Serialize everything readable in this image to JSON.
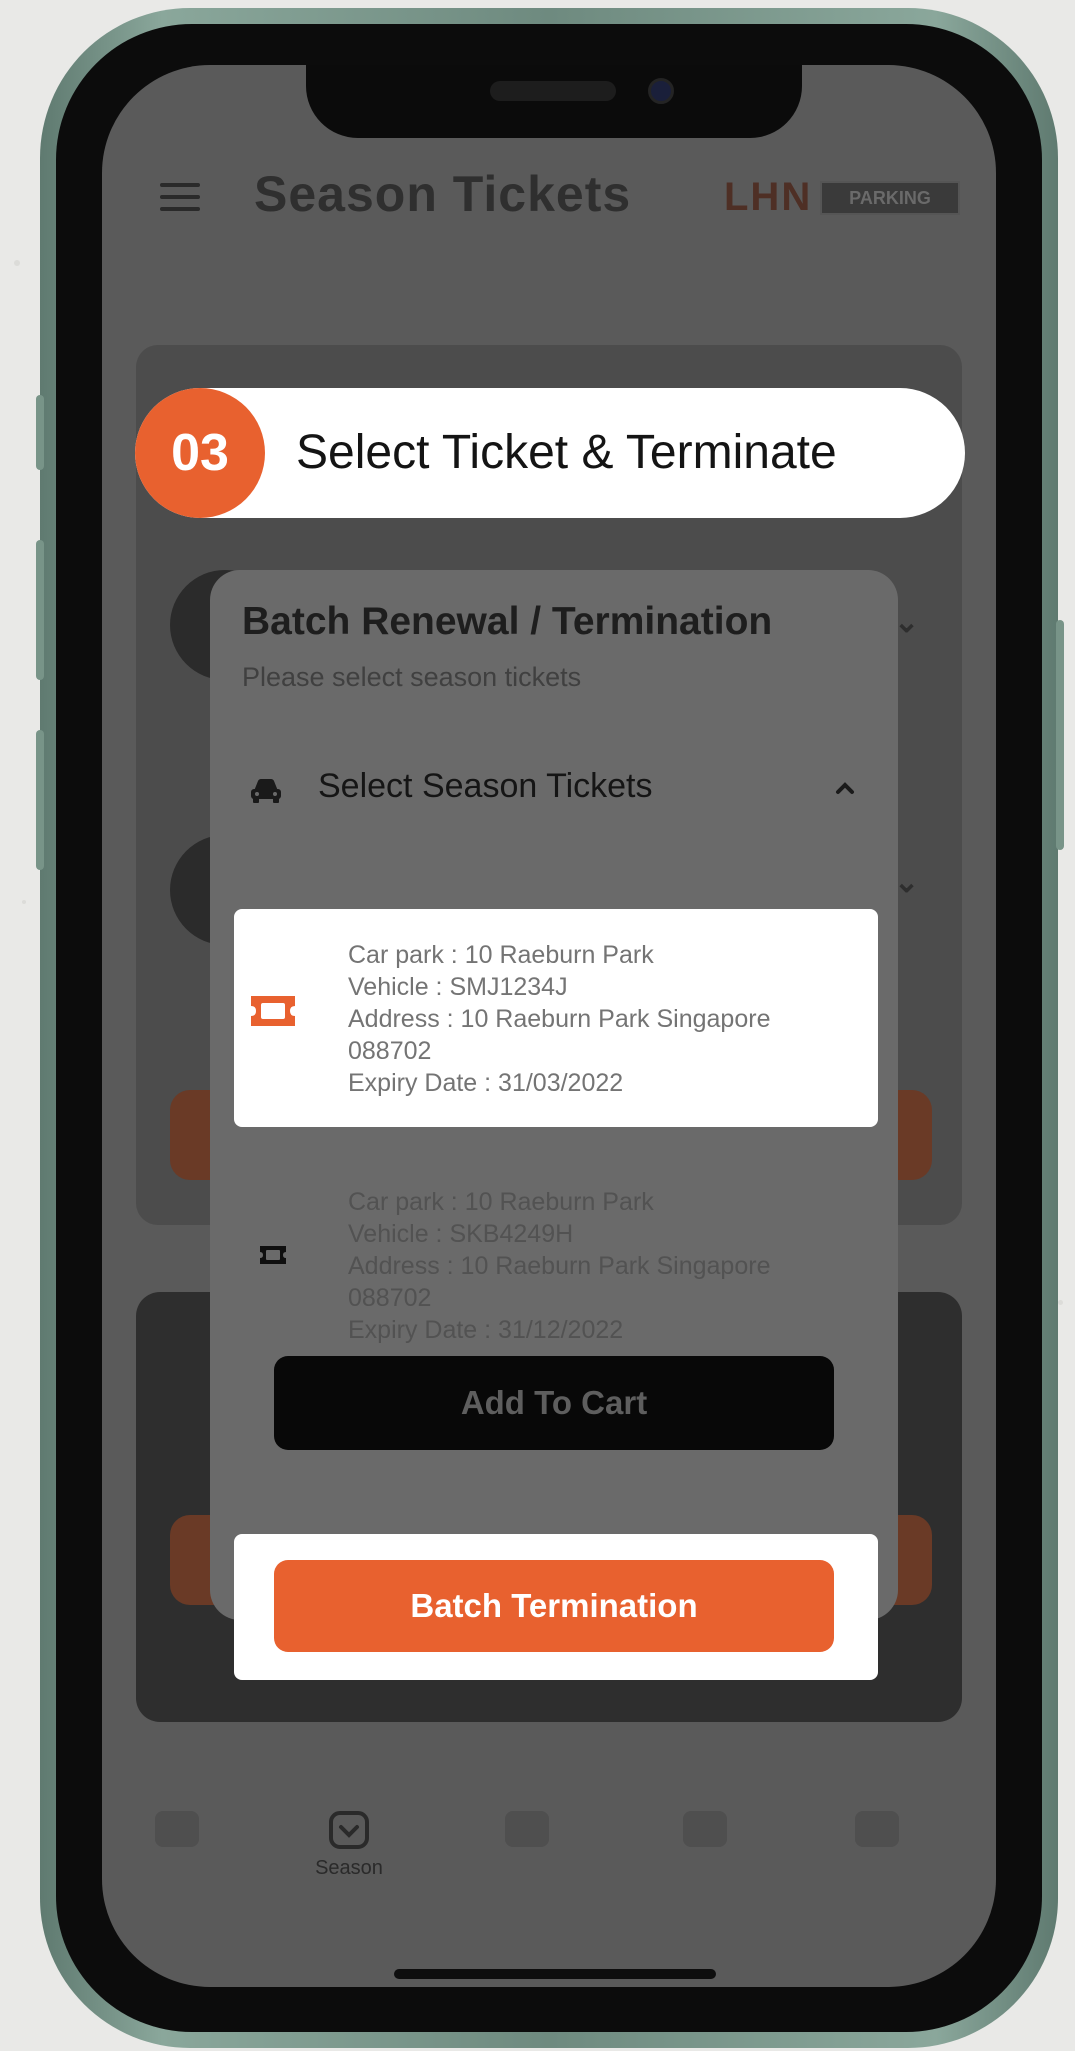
{
  "app": {
    "title": "Season Tickets",
    "brand_short": "LHN",
    "brand_word": "PARKING"
  },
  "step": {
    "number": "03",
    "text": "Select Ticket & Terminate",
    "accent_color": "#e8612f"
  },
  "modal": {
    "title": "Batch Renewal / Termination",
    "subtitle": "Please select season tickets",
    "dropdown_label": "Select Season Tickets",
    "tickets": [
      {
        "selected": true,
        "car_park": "Car park : 10 Raeburn Park",
        "vehicle": "Vehicle : SMJ1234J",
        "address": "Address : 10 Raeburn Park Singapore",
        "postal": "088702",
        "expiry": "Expiry Date : 31/03/2022"
      },
      {
        "selected": false,
        "car_park": "Car park : 10 Raeburn Park",
        "vehicle": "Vehicle : SKB4249H",
        "address": "Address : 10 Raeburn Park Singapore",
        "postal": "088702",
        "expiry": "Expiry Date : 31/12/2022"
      }
    ],
    "add_to_cart_label": "Add To Cart",
    "batch_termination_label": "Batch Termination"
  },
  "tabbar": {
    "items": [
      {
        "label": "",
        "icon": "parking-icon"
      },
      {
        "label": "Season",
        "icon": "season-ticket-icon",
        "active": true
      },
      {
        "label": "",
        "icon": "location-icon"
      },
      {
        "label": "",
        "icon": "list-icon"
      },
      {
        "label": "",
        "icon": "account-icon"
      }
    ]
  }
}
